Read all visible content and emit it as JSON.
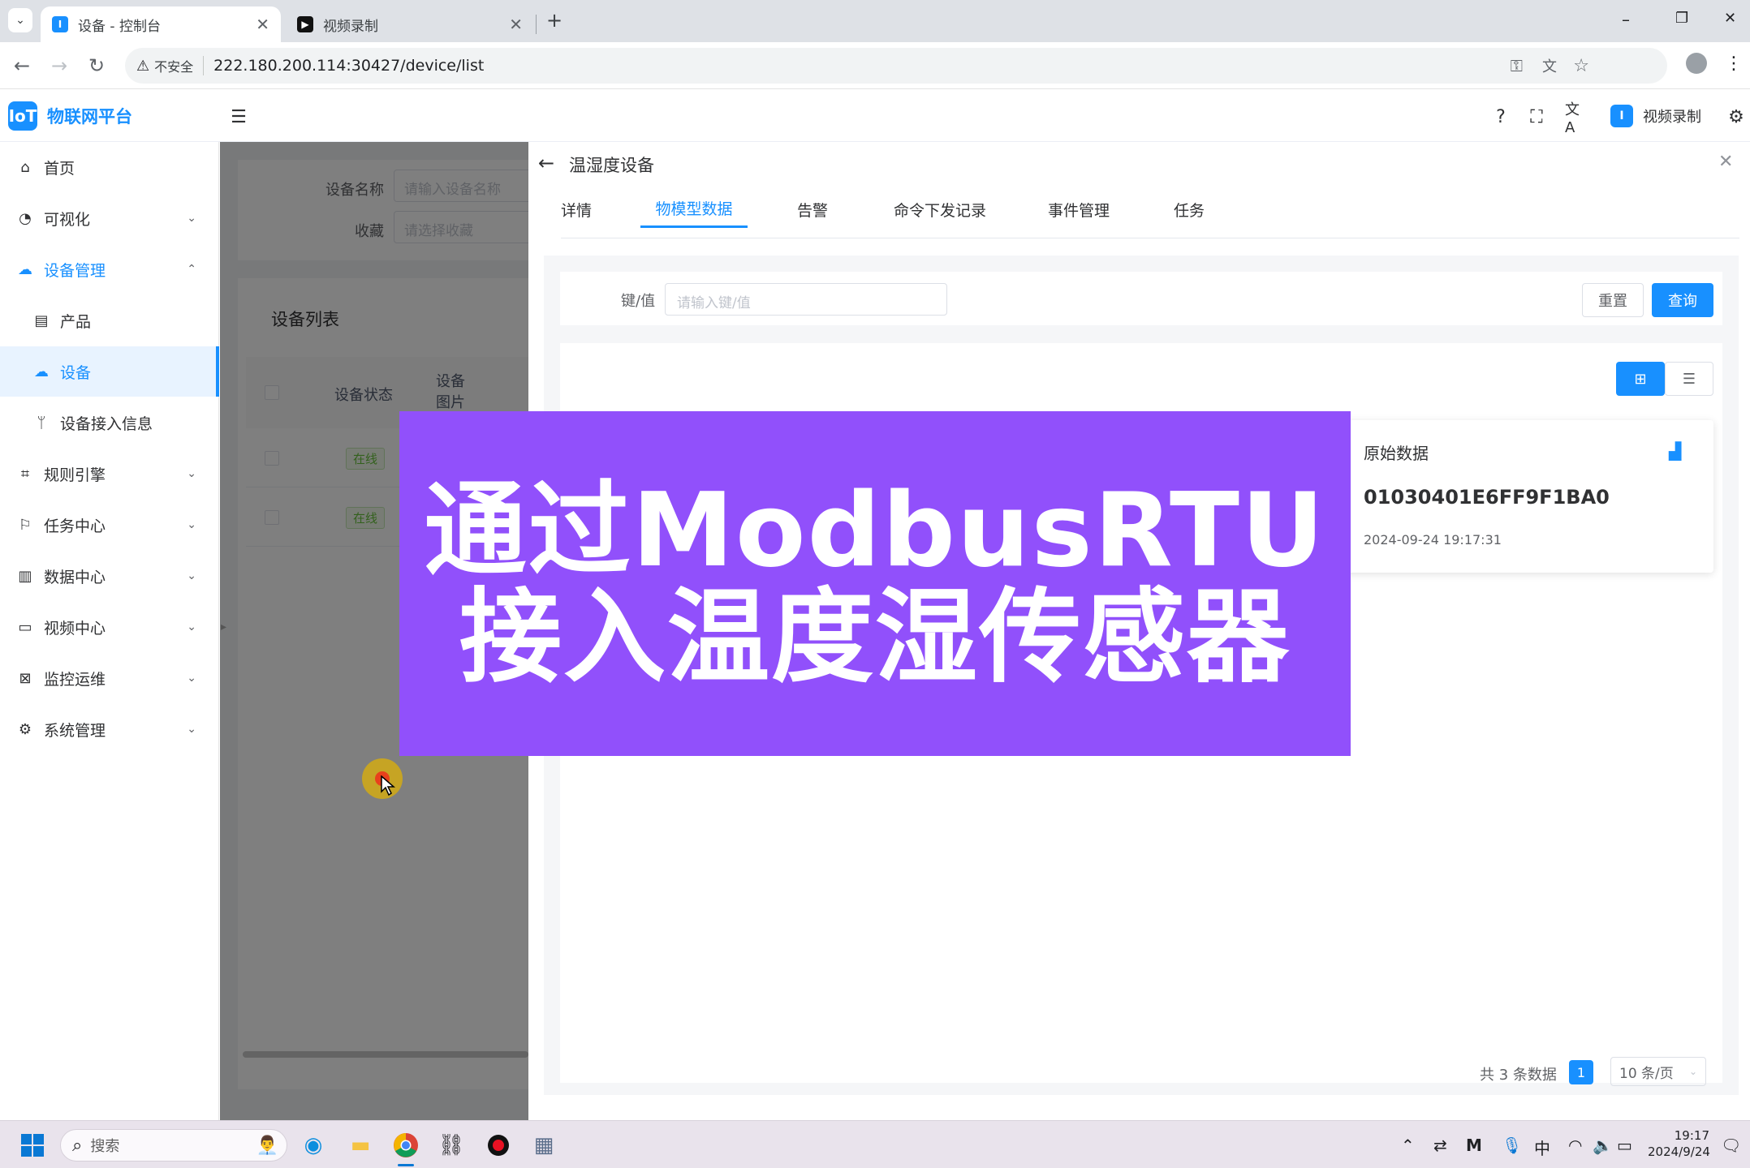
{
  "browser": {
    "tabs": [
      {
        "title": "设备 - 控制台",
        "active": true
      },
      {
        "title": "视频录制",
        "active": false
      }
    ],
    "new_tab": "+",
    "security_label": "不安全",
    "url": "222.180.200.114:30427/device/list",
    "window_controls": {
      "minimize": "–",
      "restore": "❐",
      "close": "✕"
    }
  },
  "app": {
    "logo_text": "物联网平台",
    "header_right_label": "视频录制",
    "colors": {
      "primary": "#1890ff",
      "banner": "#9150fb",
      "online_green": "#67c23a"
    }
  },
  "sidebar": {
    "items": [
      {
        "label": "首页",
        "icon": "home-icon",
        "glyph": "⌂"
      },
      {
        "label": "可视化",
        "icon": "dashboard-icon",
        "glyph": "◔",
        "chevron": "⌄"
      },
      {
        "label": "设备管理",
        "icon": "device-group-icon",
        "glyph": "☁",
        "chevron": "⌃"
      },
      {
        "label": "产品",
        "icon": "document-icon",
        "glyph": "▤"
      },
      {
        "label": "设备",
        "icon": "device-icon",
        "glyph": "☁"
      },
      {
        "label": "设备接入信息",
        "icon": "branch-icon",
        "glyph": "ᛘ"
      },
      {
        "label": "规则引擎",
        "icon": "rule-icon",
        "glyph": "⌗",
        "chevron": "⌄"
      },
      {
        "label": "任务中心",
        "icon": "task-icon",
        "glyph": "⚐",
        "chevron": "⌄"
      },
      {
        "label": "数据中心",
        "icon": "chart-icon",
        "glyph": "▥",
        "chevron": "⌄"
      },
      {
        "label": "视频中心",
        "icon": "video-icon",
        "glyph": "▭",
        "chevron": "⌄"
      },
      {
        "label": "监控运维",
        "icon": "monitor-icon",
        "glyph": "⊠",
        "chevron": "⌄"
      },
      {
        "label": "系统管理",
        "icon": "settings-icon",
        "glyph": "⚙",
        "chevron": "⌄"
      }
    ]
  },
  "list_page": {
    "filter_name_label": "设备名称",
    "filter_name_placeholder": "请输入设备名称",
    "filter_fav_label": "收藏",
    "filter_fav_placeholder": "请选择收藏",
    "list_title": "设备列表",
    "columns": [
      "设备状态",
      "设备图片"
    ],
    "rows": [
      {
        "status": "在线"
      },
      {
        "status": "在线"
      }
    ]
  },
  "drawer": {
    "title": "温湿度设备",
    "tabs": [
      "详情",
      "物模型数据",
      "告警",
      "命令下发记录",
      "事件管理",
      "任务"
    ],
    "active_tab": 1,
    "search": {
      "label": "键/值",
      "placeholder": "请输入键/值",
      "reset_label": "重置",
      "query_label": "查询"
    },
    "card": {
      "title": "原始数据",
      "value": "01030401E6FF9F1BA0",
      "time": "2024-09-24 19:17:31"
    },
    "pagination": {
      "total_text": "共 3 条数据",
      "current_page": "1",
      "page_size": "10 条/页"
    }
  },
  "banner": {
    "line1": "通过ModbusRTU",
    "line2": "接入温度湿传感器"
  },
  "taskbar": {
    "search_placeholder": "搜索",
    "ime": "中",
    "time": "19:17",
    "date": "2024/9/24"
  }
}
